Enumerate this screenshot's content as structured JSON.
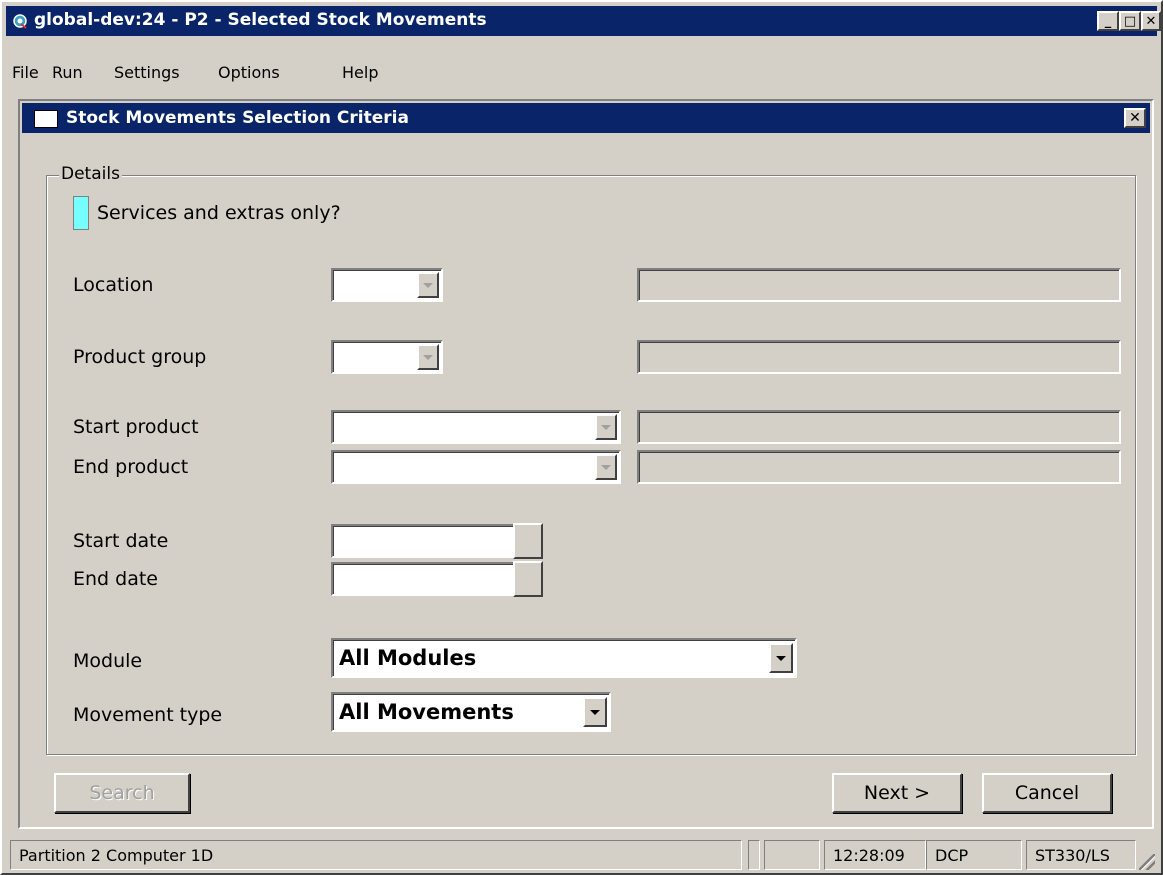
{
  "window": {
    "title": "global-dev:24 - P2 - Selected Stock Movements",
    "minimize": "_",
    "maximize": "□",
    "close": "✕"
  },
  "menu": {
    "items": [
      {
        "label": "File"
      },
      {
        "label": "Run"
      },
      {
        "label": "Settings"
      },
      {
        "label": "Options"
      },
      {
        "label": "Help"
      }
    ]
  },
  "dialog": {
    "title": "Stock Movements Selection Criteria",
    "close": "✕",
    "group_title": "Details",
    "services_label": "Services and extras only?",
    "fields": {
      "location": "Location",
      "product_group": "Product group",
      "start_product": "Start product",
      "end_product": "End product",
      "start_date": "Start date",
      "end_date": "End date",
      "module": "Module",
      "movement_type": "Movement type"
    },
    "module_value": "All Modules",
    "movement_type_value": "All Movements",
    "buttons": {
      "search": "Search",
      "next": "Next >",
      "cancel": "Cancel"
    }
  },
  "status_bar": {
    "partition": "Partition 2 Computer 1D",
    "time": "12:28:09",
    "user": "DCP",
    "program": "ST330/LS"
  },
  "colors": {
    "titlebar": "#0a246a",
    "checkbox": "#77ffff"
  }
}
